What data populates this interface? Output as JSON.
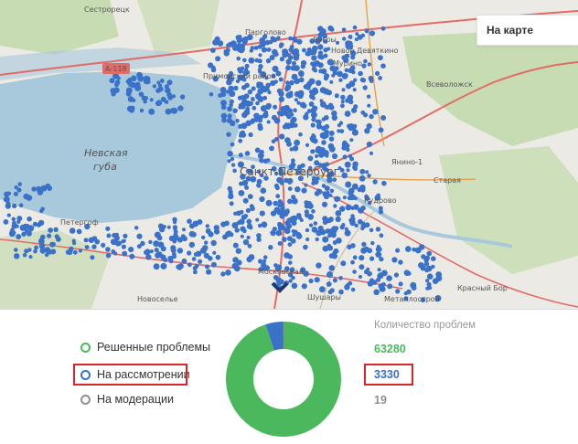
{
  "map": {
    "tab_label": "На карте",
    "water_label_line1": "Невская",
    "water_label_line2": "губа",
    "city_label": "Санкт-Петербург",
    "places": [
      "Сестрорецк",
      "Парголово",
      "Бугры",
      "Новое Девяткино",
      "Мурино",
      "Всеволожск",
      "Приморский район",
      "Янино-1",
      "Старая",
      "Кудрово",
      "Петергоф",
      "Новоселье",
      "Шушары",
      "Металлострой",
      "Московская",
      "Красный Бор"
    ],
    "road_badge": "А-118",
    "colors": {
      "water": "#a8c8dc",
      "land": "#eceae4",
      "forest": "#c7dcb2",
      "road": "#e36b67",
      "problem_point": "#3a71c9"
    }
  },
  "legend": {
    "items": [
      {
        "label": "Решенные проблемы",
        "color": "#4cb85e"
      },
      {
        "label": "На рассмотрении",
        "color": "#3a71c9"
      },
      {
        "label": "На модерации",
        "color": "#8f8f8f"
      }
    ]
  },
  "counts": {
    "title": "Количество проблем",
    "values": [
      {
        "value": "63280",
        "color": "#4cb85e"
      },
      {
        "value": "3330",
        "color": "#3a71c9"
      },
      {
        "value": "19",
        "color": "#8f8f8f"
      }
    ]
  },
  "chart_data": {
    "type": "pie",
    "categories": [
      "Решенные проблемы",
      "На рассмотрении",
      "На модерации"
    ],
    "values": [
      63280,
      3330,
      19
    ],
    "colors": [
      "#4cb85e",
      "#3a71c9",
      "#8f8f8f"
    ]
  }
}
